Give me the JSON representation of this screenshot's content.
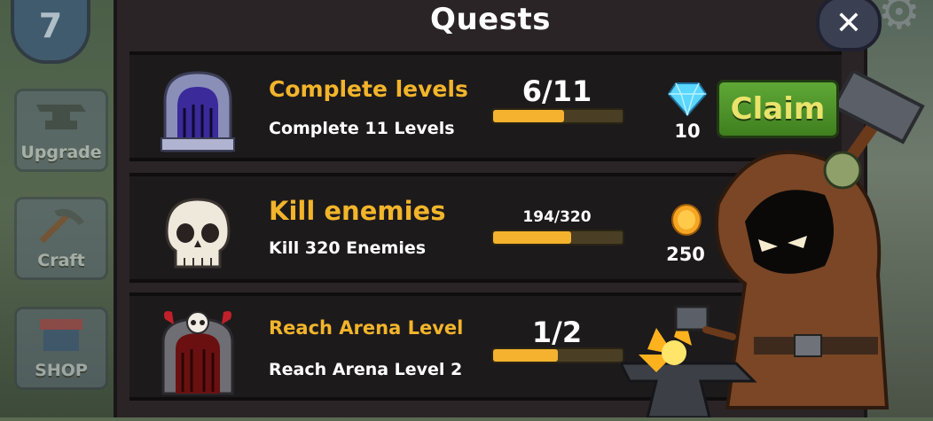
{
  "hud": {
    "level": "7",
    "side_buttons": [
      {
        "label": "Upgrade"
      },
      {
        "label": "Craft"
      },
      {
        "label": "SHOP"
      }
    ]
  },
  "dialog": {
    "title": "Quests",
    "close_symbol": "✕"
  },
  "quests": [
    {
      "icon": "dungeon-door-icon",
      "title": "Complete levels",
      "description": "Complete 11 Levels",
      "progress_text": "6/11",
      "progress": 0.545,
      "reward_icon": "diamond-icon",
      "reward_amount": "10",
      "action": "Claim"
    },
    {
      "icon": "skull-icon",
      "title": "Kill enemies",
      "description": "Kill 320 Enemies",
      "progress_text": "194/320",
      "progress": 0.606,
      "reward_icon": "gold-coin-icon",
      "reward_amount": "250"
    },
    {
      "icon": "arena-gate-icon",
      "title": "Reach Arena Level",
      "description": "Reach Arena Level 2",
      "progress_text": "1/2",
      "progress": 0.5
    }
  ],
  "colors": {
    "quest_title": "#f2b42a",
    "progress_fill": "#f4b22e",
    "claim_button": "#4e9428",
    "panel": "#2a2426"
  }
}
